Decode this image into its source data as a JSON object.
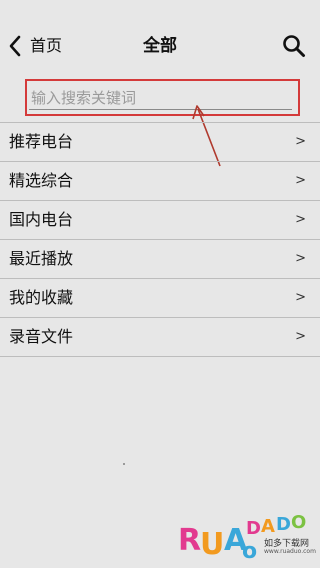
{
  "header": {
    "back_label": "首页",
    "title": "全部",
    "back_icon": "chevron-left-icon",
    "search_icon": "search-icon"
  },
  "search": {
    "placeholder": "输入搜索关键词",
    "value": "",
    "highlight_color": "#d43a3a"
  },
  "list": {
    "items": [
      {
        "label": "推荐电台",
        "chevron": ">"
      },
      {
        "label": "精选综合",
        "chevron": ">"
      },
      {
        "label": "国内电台",
        "chevron": ">"
      },
      {
        "label": "最近播放",
        "chevron": ">"
      },
      {
        "label": "我的收藏",
        "chevron": ">"
      },
      {
        "label": "录音文件",
        "chevron": ">"
      }
    ]
  },
  "watermark": {
    "brand": "RUANDADO",
    "tagline": "如多下载网",
    "url": "www.ruaduo.com"
  },
  "colors": {
    "background": "#e7e7e7",
    "divider": "#bdbdbd",
    "annotation_red": "#c0392b"
  }
}
